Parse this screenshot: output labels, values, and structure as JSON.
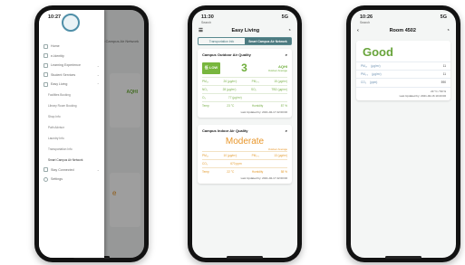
{
  "phone1": {
    "time": "10:27",
    "signal": "5G",
    "under_tab": "Smart Campus Air Network",
    "under_aqi": "AQHI",
    "under_mod": "e",
    "menu": [
      {
        "label": "Home",
        "icon": "home-icon"
      },
      {
        "label": "e-Identity",
        "icon": "id-card-icon"
      },
      {
        "label": "Learning Experience",
        "icon": "book-icon",
        "chevron": true
      },
      {
        "label": "Student Services",
        "icon": "people-icon",
        "chevron": true
      },
      {
        "label": "Easy Living",
        "icon": "house-icon",
        "chevron": true
      }
    ],
    "submenu": [
      "Facilities Booking",
      "Library Room Booking",
      "Shop Info",
      "Path Advisor",
      "Laundry Info",
      "Transportation Info",
      "Smart Campus Air Network"
    ],
    "menu_bottom": [
      {
        "label": "Stay Connected",
        "icon": "link-icon",
        "chevron": true
      },
      {
        "label": "Settings",
        "icon": "gear-icon"
      }
    ]
  },
  "phone2": {
    "time": "11:30",
    "signal": "5G",
    "search": "Search",
    "title": "Easy Living",
    "tabs": [
      "Transportation Info",
      "Smart Campus Air Network"
    ],
    "outdoor": {
      "title": "Campus Outdoor Air Quality",
      "badge": "低 LOW",
      "aqi": "3",
      "aqi_label": "AQHI",
      "aqi_sub": "Outdoor Average",
      "rows": [
        [
          "PM₁₀",
          "26 (μg/m³)",
          "PM₂.₅",
          "15 (μg/m³)"
        ],
        [
          "NO₂",
          "28 (μg/m³)",
          "SO₂",
          "TBD (μg/m³)"
        ],
        [
          "O₃",
          "77 (μg/m³)",
          "",
          ""
        ],
        [
          "Temp",
          "23 °C",
          "Humidity",
          "87 %"
        ]
      ],
      "updated": "Last Updated by: 2021-02-17 22:00:00"
    },
    "indoor": {
      "title": "Campus Indoor Air Quality",
      "level": "Moderate",
      "level_sub": "Outdoor Average",
      "rows": [
        [
          "PM₁₀",
          "10 (μg/m³)",
          "PM₂.₅",
          "13 (μg/m³)"
        ],
        [
          "CO₂",
          "670 ppm",
          "",
          ""
        ],
        [
          "Temp",
          "22 °C",
          "Humidity",
          "58 %"
        ]
      ],
      "updated": "Last Updated by: 2021-02-17 22:00:00"
    }
  },
  "phone3": {
    "time": "10:26",
    "signal": "5G",
    "search": "Search",
    "title": "Room 4502",
    "level": "Good",
    "rows": [
      [
        "PM₁₀",
        "(μg/m³)",
        "11"
      ],
      [
        "PM₂.₅",
        "(μg/m³)",
        "11"
      ],
      [
        "CO₂",
        "(ppm)",
        "590"
      ]
    ],
    "temp": "23 °C / 59 %",
    "updated": "Last Updated by: 2021-02-16 10:23:00"
  },
  "colors": {
    "accent": "#4c7a80",
    "good": "#6fae3b",
    "moderate": "#e8962a"
  }
}
